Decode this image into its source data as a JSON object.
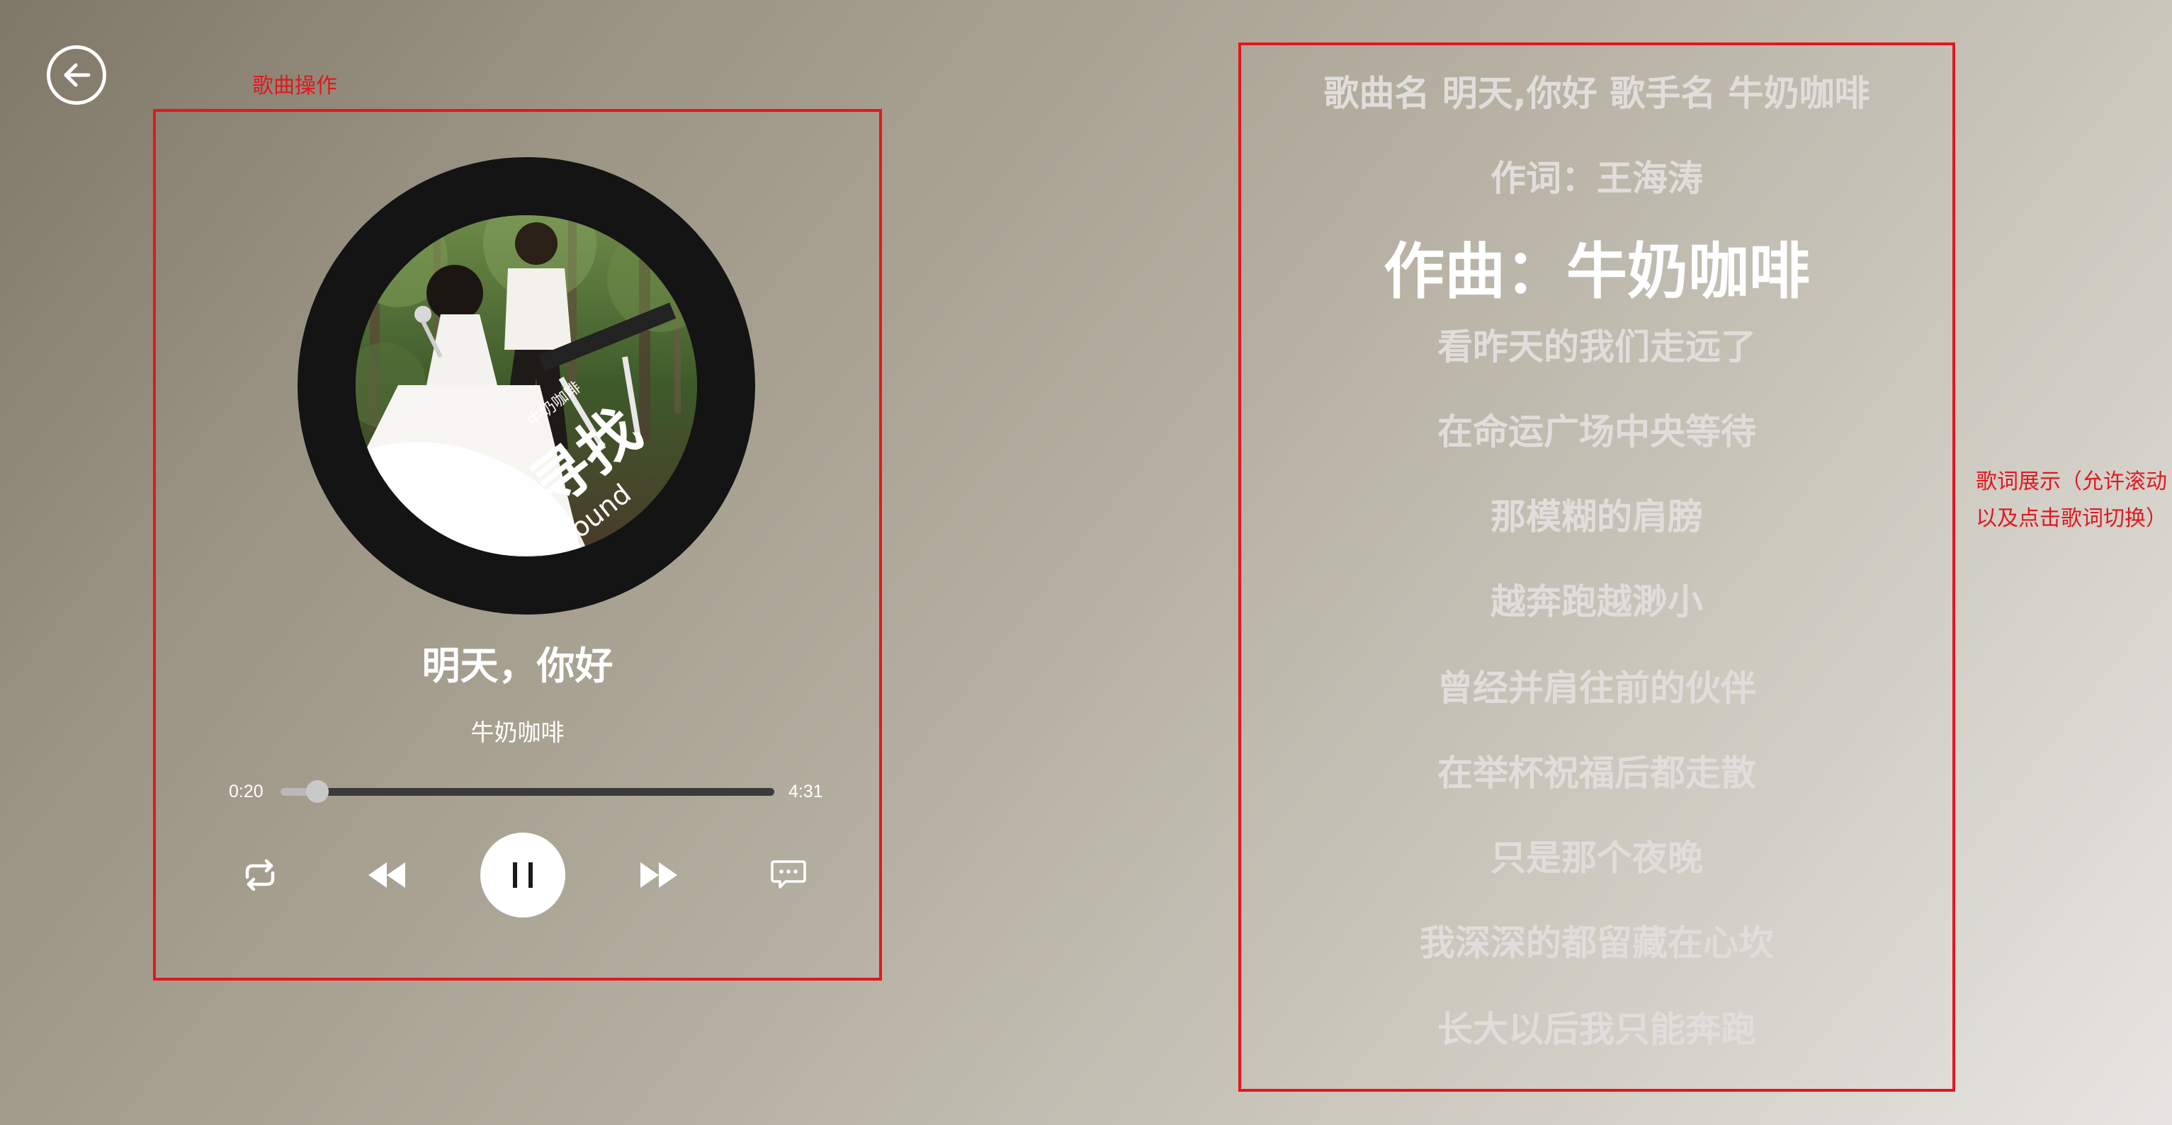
{
  "annotations": {
    "operation_label": "歌曲操作",
    "lyrics_label": "歌词展示（允许滚动以及点击歌词切换）"
  },
  "player": {
    "title": "明天，你好",
    "artist": "牛奶咖啡",
    "current_time": "0:20",
    "total_time": "4:31",
    "progress": 0.074,
    "state": "playing",
    "cover_text": "走寻找 · Found",
    "cover_small_text": "牛奶咖啡"
  },
  "lyrics": {
    "active_index": 2,
    "lines": [
      "歌曲名 明天,你好 歌手名 牛奶咖啡",
      "作词：王海涛",
      "作曲：牛奶咖啡",
      "看昨天的我们走远了",
      "在命运广场中央等待",
      "那模糊的肩膀",
      "越奔跑越渺小",
      "曾经并肩往前的伙伴",
      "在举杯祝福后都走散",
      "只是那个夜晚",
      "我深深的都留藏在心坎",
      "长大以后我只能奔跑"
    ]
  },
  "colors": {
    "annotation": "#e3171f",
    "disc": "#141414",
    "track": "#3a3a3a",
    "lyric_inactive": "#e0dedb",
    "lyric_active": "#ffffff"
  },
  "icons": {
    "back": "arrow-left-circle-icon",
    "loop": "repeat-icon",
    "prev": "rewind-icon",
    "pause": "pause-icon",
    "next": "fast-forward-icon",
    "lyric": "lyrics-bubble-icon"
  }
}
